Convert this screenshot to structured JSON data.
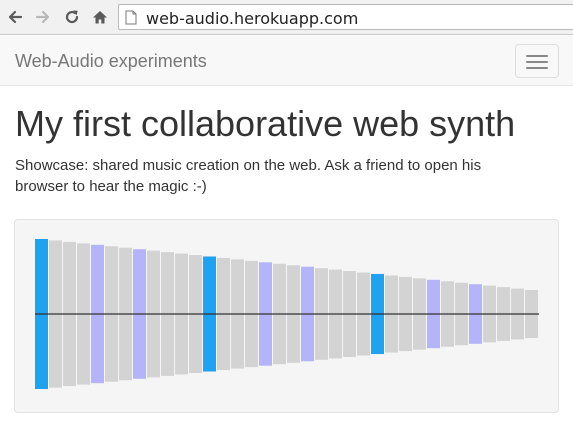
{
  "browser": {
    "url": "web-audio.herokuapp.com",
    "icons": [
      "back-arrow-icon",
      "forward-arrow-icon",
      "reload-icon",
      "home-icon",
      "page-icon"
    ]
  },
  "navbar": {
    "brand": "Web-Audio experiments",
    "toggle_icon": "hamburger-menu-icon"
  },
  "main": {
    "title": "My first collaborative web synth",
    "description": "Showcase: shared music creation on the web. Ask a friend to open his browser to hear the magic :-)"
  },
  "synth": {
    "key_count": 36,
    "states": [
      "blue",
      "gray",
      "gray",
      "gray",
      "purple",
      "gray",
      "gray",
      "purple",
      "gray",
      "gray",
      "gray",
      "gray",
      "blue",
      "gray",
      "gray",
      "gray",
      "purple",
      "gray",
      "gray",
      "purple",
      "gray",
      "gray",
      "gray",
      "gray",
      "blue",
      "gray",
      "gray",
      "gray",
      "purple",
      "gray",
      "gray",
      "purple",
      "gray",
      "gray",
      "gray",
      "gray"
    ],
    "colors": {
      "blue": "#1ea2f2",
      "gray": "#d3d3d3",
      "purple": "#b4b4fb",
      "line": "#333333",
      "background": "#f5f5f5"
    }
  }
}
